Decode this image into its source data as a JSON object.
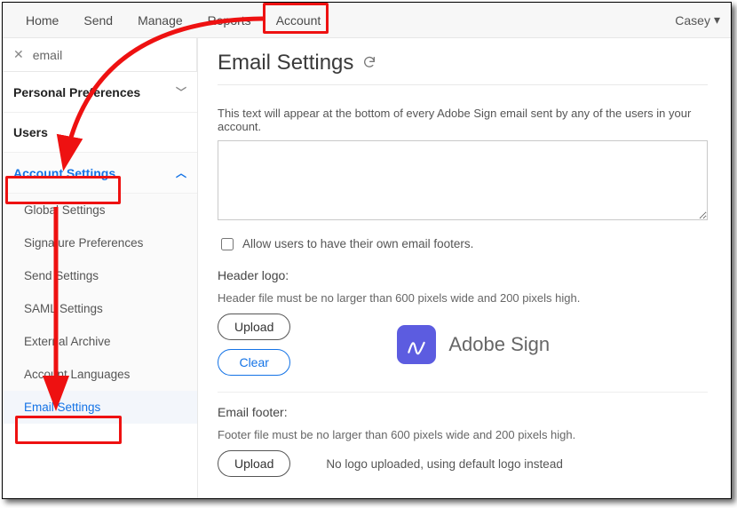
{
  "topnav": {
    "tabs": [
      "Home",
      "Send",
      "Manage",
      "Reports",
      "Account"
    ],
    "user": "Casey"
  },
  "sidebar": {
    "search_value": "email",
    "sections": {
      "personal": {
        "label": "Personal Preferences"
      },
      "users": {
        "label": "Users"
      },
      "account": {
        "label": "Account Settings",
        "items": [
          "Global Settings",
          "Signature Preferences",
          "Send Settings",
          "SAML Settings",
          "External Archive",
          "Account Languages",
          "Email Settings"
        ]
      }
    }
  },
  "main": {
    "title": "Email Settings",
    "footer_desc": "This text will appear at the bottom of every Adobe Sign email sent by any of the users in your account.",
    "footer_text": "",
    "allow_own_label": "Allow users to have their own email footers.",
    "header_label": "Header logo:",
    "header_hint": "Header file must be no larger than 600 pixels wide and 200 pixels high.",
    "upload_label": "Upload",
    "clear_label": "Clear",
    "brand_name": "Adobe Sign",
    "footer_label": "Email footer:",
    "footer_hint": "Footer file must be no larger than 600 pixels wide and 200 pixels high.",
    "footer_msg": "No logo uploaded, using default logo instead"
  }
}
